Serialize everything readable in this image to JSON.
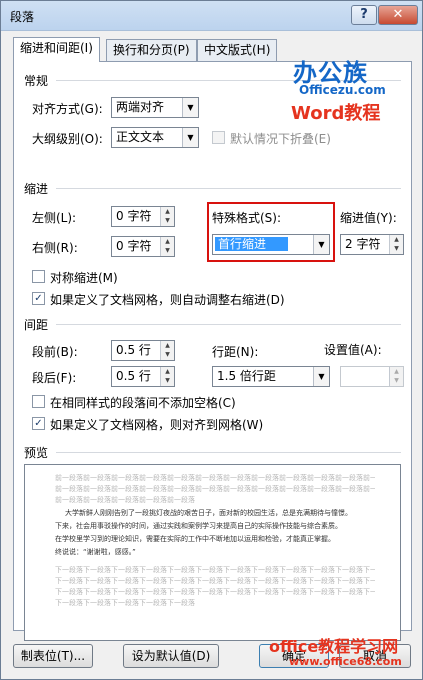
{
  "title": "段落",
  "tabs": [
    "缩进和间距(I)",
    "换行和分页(P)",
    "中文版式(H)"
  ],
  "general": {
    "section": "常规",
    "align_label": "对齐方式(G):",
    "align_value": "两端对齐",
    "outline_label": "大纲级别(O):",
    "outline_value": "正文文本",
    "collapse_label": "默认情况下折叠(E)"
  },
  "indent": {
    "section": "缩进",
    "left_label": "左侧(L):",
    "left_value": "0 字符",
    "right_label": "右侧(R):",
    "right_value": "0 字符",
    "special_label": "特殊格式(S):",
    "special_value": "首行缩进",
    "by_label": "缩进值(Y):",
    "by_value": "2 字符",
    "mirror_label": "对称缩进(M)",
    "auto_label": "如果定义了文档网格，则自动调整右缩进(D)"
  },
  "spacing": {
    "section": "间距",
    "before_label": "段前(B):",
    "before_value": "0.5 行",
    "after_label": "段后(F):",
    "after_value": "0.5 行",
    "line_label": "行距(N):",
    "line_value": "1.5 倍行距",
    "at_label": "设置值(A):",
    "at_value": "",
    "nospace_label": "在相同样式的段落间不添加空格(C)",
    "grid_label": "如果定义了文档网格，则对齐到网格(W)"
  },
  "preview": {
    "section": "预览",
    "prev": [
      "前一段落前一段落前一段落前一段落前一段落前一段落前一段落前一段落前一段落前一段落前一段落前一段落",
      "前一段落前一段落前一段落前一段落前一段落前一段落前一段落前一段落前一段落前一段落前一段落前一段落",
      "前一段落前一段落前一段落前一段落前一段落"
    ],
    "main": [
      "大学新鲜人刚刚告别了一段挑灯夜战的艰苦日子，面对新的校园生活，总是充满期待与憧憬。",
      "下来，社会用事驳操作的时间，通过实践和案例学习来提高自己的实际操作技能与综合素质。",
      "在学校里学习到的理论知识，需要在实际的工作中不断地加以运用和检验，才能真正掌握。",
      "终说说：“谢谢啦，感感。”"
    ],
    "next": [
      "下一段落下一段落下一段落下一段落下一段落下一段落下一段落下一段落下一段落下一段落下一段落下一段落",
      "下一段落下一段落下一段落下一段落下一段落下一段落下一段落下一段落下一段落下一段落下一段落下一段落",
      "下一段落下一段落下一段落下一段落下一段落下一段落下一段落下一段落下一段落下一段落下一段落下一段落",
      "下一段落下一段落下一段落下一段落下一段落"
    ]
  },
  "buttons": {
    "tabs": "制表位(T)...",
    "default": "设为默认值(D)",
    "ok": "确定",
    "cancel": "取消"
  },
  "logo": {
    "line1": "办公族",
    "line2": "Officezu.com",
    "line3": "Word教程"
  },
  "watermark": {
    "line1": "office教程学习网",
    "line2": "www.office68.com"
  },
  "colors": {
    "accent_red": "#d8120e",
    "logo_blue": "#1467c7",
    "logo_red": "#e5341f",
    "selection": "#3399ff"
  }
}
